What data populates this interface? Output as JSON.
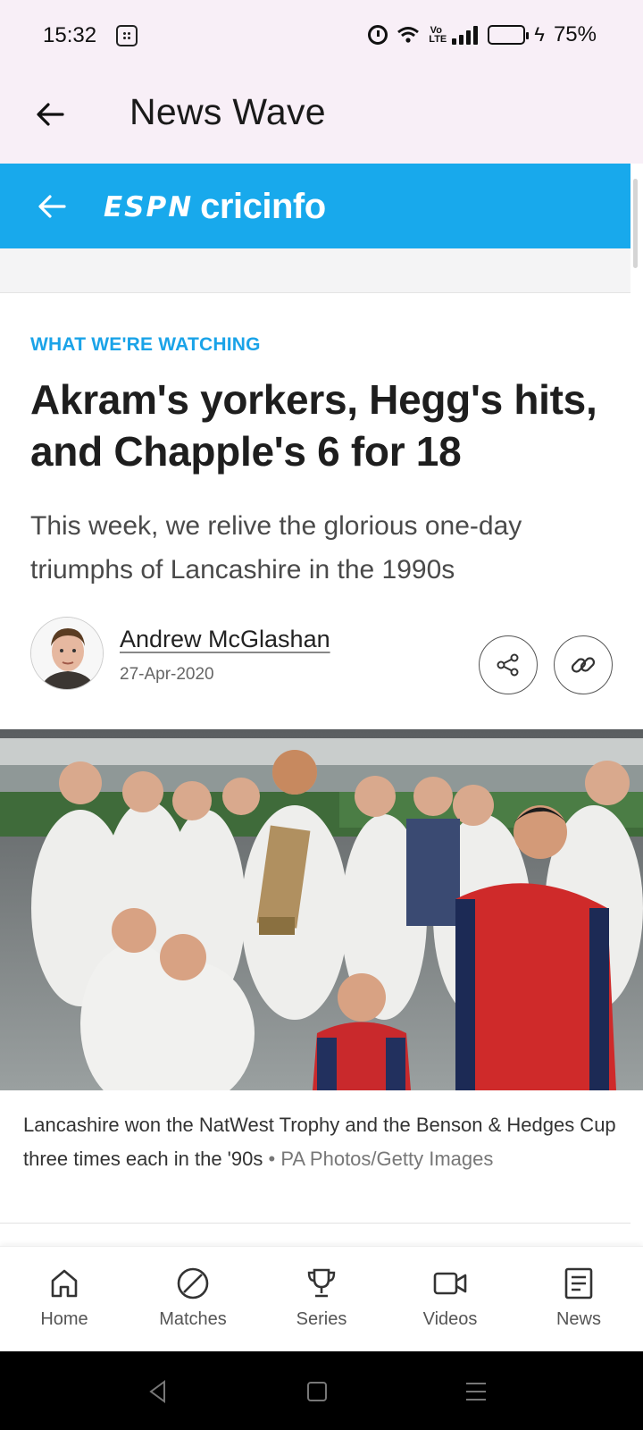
{
  "status_bar": {
    "time": "15:32",
    "volte": "Vo LTE",
    "battery_percent": "75%",
    "battery_level": 0.75
  },
  "app_bar": {
    "title": "News Wave",
    "back_icon": "arrow-left-icon"
  },
  "source": {
    "logo_mark": "ESPN",
    "logo_word": "cricinfo",
    "brand_color": "#18a9ec"
  },
  "article": {
    "kicker": "WHAT WE'RE WATCHING",
    "headline": "Akram's yorkers, Hegg's hits, and Chapple's 6 for 18",
    "subhead": "This week, we relive the glorious one-day triumphs of Lancashire in the 1990s",
    "author": "Andrew McGlashan",
    "date": "27-Apr-2020",
    "actions": [
      {
        "icon": "share-icon"
      },
      {
        "icon": "link-icon"
      }
    ],
    "image_caption": "Lancashire won the NatWest Trophy and the Benson & Hedges Cup three times each in the '90s",
    "image_separator": "•",
    "image_credit": "PA Photos/Getty Images"
  },
  "bottom_nav": [
    {
      "label": "Home",
      "icon": "home-icon"
    },
    {
      "label": "Matches",
      "icon": "ball-icon"
    },
    {
      "label": "Series",
      "icon": "trophy-icon"
    },
    {
      "label": "Videos",
      "icon": "video-icon"
    },
    {
      "label": "News",
      "icon": "news-icon"
    }
  ],
  "system_nav": [
    "back-triangle-icon",
    "home-square-icon",
    "menu-lines-icon"
  ]
}
